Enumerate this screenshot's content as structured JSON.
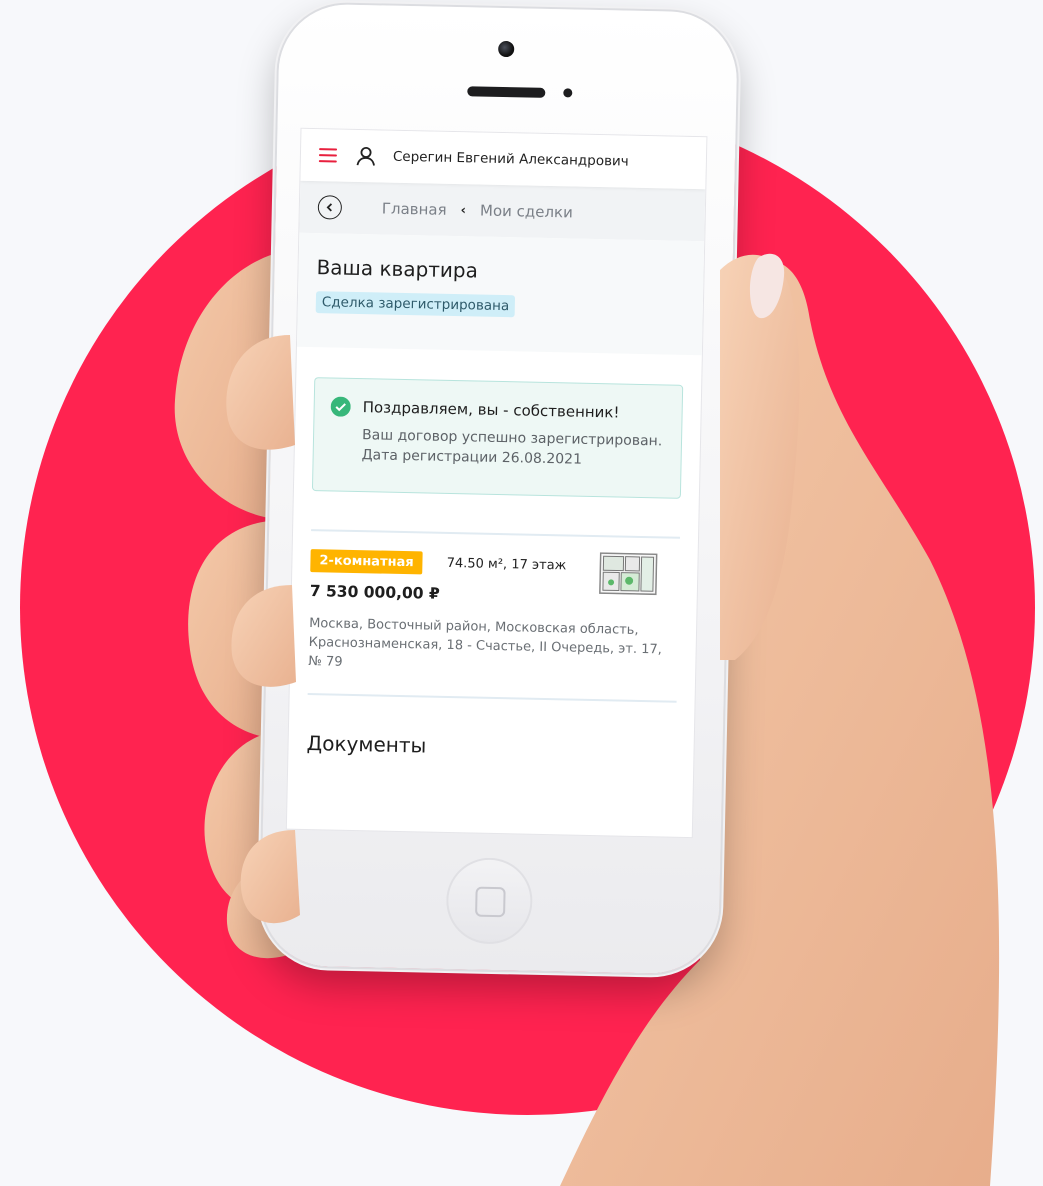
{
  "colors": {
    "circle": "#ff2350",
    "accent": "#e8203e",
    "status_badge_bg": "#cfeef8",
    "success_bg": "#eef8f5",
    "success_check": "#37b77a",
    "rooms_badge": "#ffb400"
  },
  "header": {
    "menu_icon": "hamburger-icon",
    "user_icon": "user-icon",
    "user_name": "Серегин Евгений Александрович"
  },
  "breadcrumb": {
    "back_icon": "chevron-left-icon",
    "items": [
      "Главная",
      "Мои сделки"
    ]
  },
  "page": {
    "title": "Ваша квартира",
    "status": "Сделка зарегистрирована"
  },
  "success": {
    "icon": "check-circle-icon",
    "title": "Поздравляем, вы - собственник!",
    "text": "Ваш договор успешно зарегистрирован. Дата регистрации 26.08.2021"
  },
  "flat": {
    "rooms": "2-комнатная",
    "area_floor": "74.50 м², 17 этаж",
    "price": "7 530 000,00 ₽",
    "address": "Москва, Восточный район, Московская область, Краснознаменская, 18 - Счастье, II Очередь, эт. 17, № 79",
    "plan_icon": "floor-plan-icon"
  },
  "documents": {
    "title": "Документы"
  }
}
